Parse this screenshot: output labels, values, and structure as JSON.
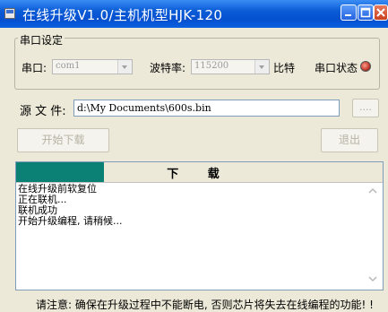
{
  "window": {
    "title": "在线升级V1.0/主机机型HJK-120"
  },
  "serial": {
    "group_label": "串口设定",
    "port_label": "串口:",
    "port_value": "com1",
    "baud_label": "波特率:",
    "baud_value": "115200",
    "baud_unit": "比特",
    "status_label": "串口状态",
    "status_color": "#c0392b"
  },
  "source": {
    "label": "源 文 件:",
    "path": "d:\\My Documents\\600s.bin",
    "browse_label": "...."
  },
  "actions": {
    "start_label": "开始下载",
    "exit_label": "退出"
  },
  "progress": {
    "label": "下 载",
    "fraction": 0.24,
    "color": "#0b8176"
  },
  "log": {
    "lines": [
      "在线升级前软复位",
      "正在联机...",
      "联机成功",
      "开始升级编程, 请稍候..."
    ]
  },
  "notice": {
    "text": "请注意: 确保在升级过程中不能断电, 否则芯片将失去在线编程的功能! !"
  }
}
